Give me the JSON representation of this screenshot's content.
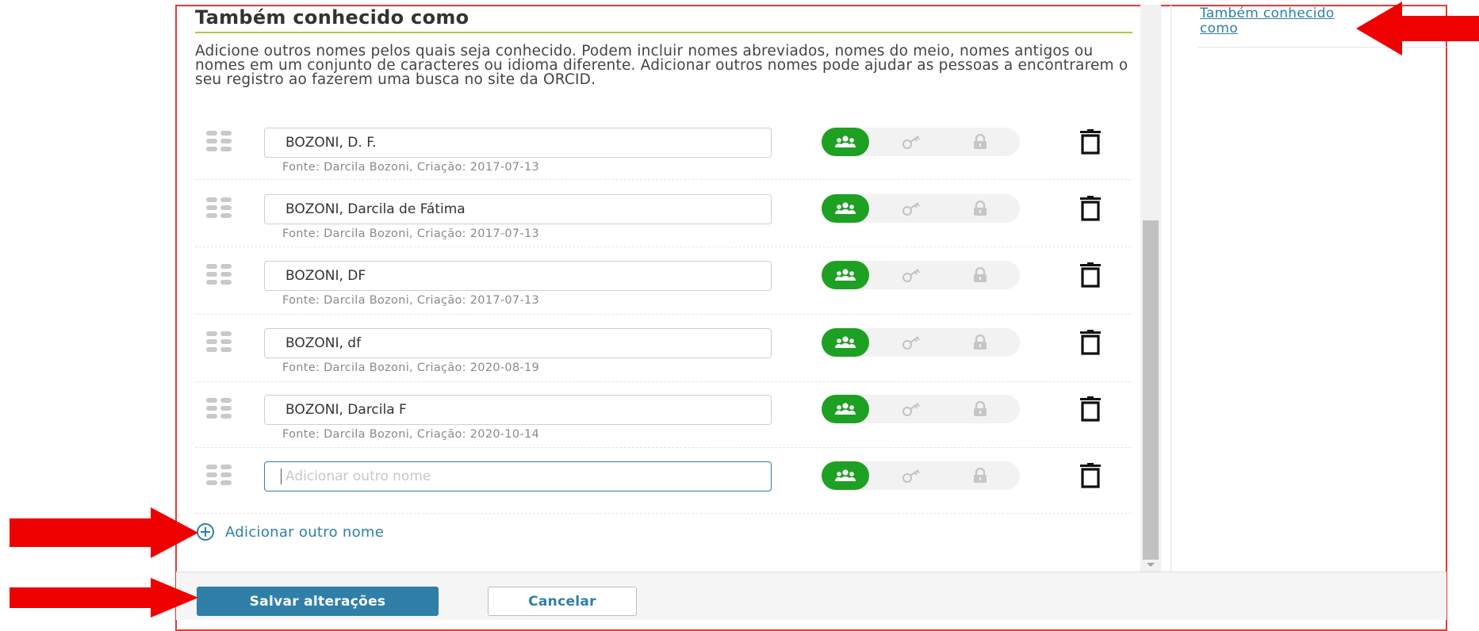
{
  "dialog": {
    "title": "Também conhecido como",
    "description": "Adicione outros nomes pelos quais seja conhecido. Podem incluir nomes abreviados, nomes do meio, nomes antigos ou nomes em um conjunto de caracteres ou idioma diferente. Adicionar outros nomes pode ajudar as pessoas a encontrarem o seu registro ao fazerem uma busca no site da ORCID."
  },
  "names": [
    {
      "value": "BOZONI, D. F.",
      "source": "Fonte: Darcila Bozoni, Criação: 2017-07-13"
    },
    {
      "value": "BOZONI, Darcila de Fátima",
      "source": "Fonte: Darcila Bozoni, Criação: 2017-07-13"
    },
    {
      "value": "BOZONI, DF",
      "source": "Fonte: Darcila Bozoni, Criação: 2017-07-13"
    },
    {
      "value": "BOZONI, df",
      "source": "Fonte: Darcila Bozoni, Criação: 2020-08-19"
    },
    {
      "value": "BOZONI, Darcila F",
      "source": "Fonte: Darcila Bozoni, Criação: 2020-10-14"
    }
  ],
  "new_name": {
    "placeholder": "Adicionar outro nome",
    "value": ""
  },
  "privacy": {
    "selected": "everyone",
    "colors": {
      "selected": "#1ea022",
      "inactive": "#f2f2f2"
    }
  },
  "add_link_label": "Adicionar outro nome",
  "sidebar": {
    "link_label": "Também conhecido como"
  },
  "footer": {
    "save_label": "Salvar alterações",
    "cancel_label": "Cancelar"
  },
  "colors": {
    "accent": "#2f7fa8",
    "highlight": "#e53935",
    "title_rule": "#b5c64a"
  }
}
